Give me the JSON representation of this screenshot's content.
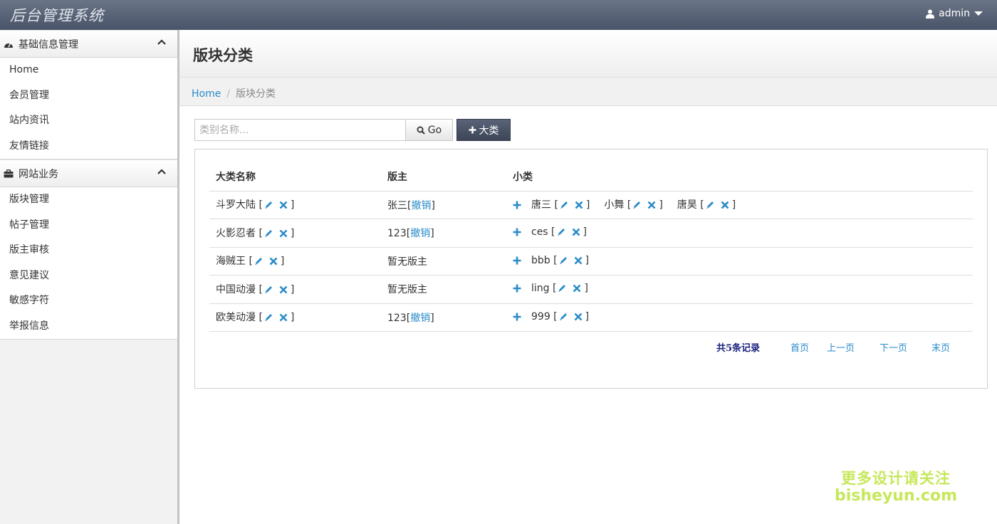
{
  "app": {
    "title": "后台管理系统",
    "user": "admin"
  },
  "sidebar": {
    "sections": [
      {
        "label": "基础信息管理",
        "items": [
          "Home",
          "会员管理",
          "站内资讯",
          "友情链接"
        ]
      },
      {
        "label": "网站业务",
        "items": [
          "版块管理",
          "帖子管理",
          "版主审核",
          "意见建议",
          "敏感字符",
          "举报信息"
        ]
      }
    ]
  },
  "page": {
    "title": "版块分类"
  },
  "breadcrumb": {
    "home": "Home",
    "current": "版块分类"
  },
  "toolbar": {
    "search_placeholder": "类别名称...",
    "go_label": "Go",
    "add_label": "大类"
  },
  "table": {
    "headers": [
      "大类名称",
      "版主",
      "小类"
    ],
    "rows": [
      {
        "name": "斗罗大陆",
        "moderator": "张三",
        "revoke": "撤销",
        "subs": [
          "唐三",
          "小舞",
          "唐昊"
        ]
      },
      {
        "name": "火影忍者",
        "moderator": "123",
        "revoke": "撤销",
        "subs": [
          "ces"
        ]
      },
      {
        "name": "海贼王",
        "moderator": "暂无版主",
        "revoke": "",
        "subs": [
          "bbb"
        ]
      },
      {
        "name": "中国动漫",
        "moderator": "暂无版主",
        "revoke": "",
        "subs": [
          "ling"
        ]
      },
      {
        "name": "欧美动漫",
        "moderator": "123",
        "revoke": "撤销",
        "subs": [
          "999"
        ]
      }
    ]
  },
  "pager": {
    "total": "共5条记录",
    "first": "首页",
    "prev": "上一页",
    "next": "下一页",
    "last": "末页"
  },
  "watermark": {
    "line1": "更多设计请关注",
    "line2": "bisheyun.com"
  },
  "colors": {
    "accent": "#2a8bc9",
    "topbar": "#4a5468"
  }
}
